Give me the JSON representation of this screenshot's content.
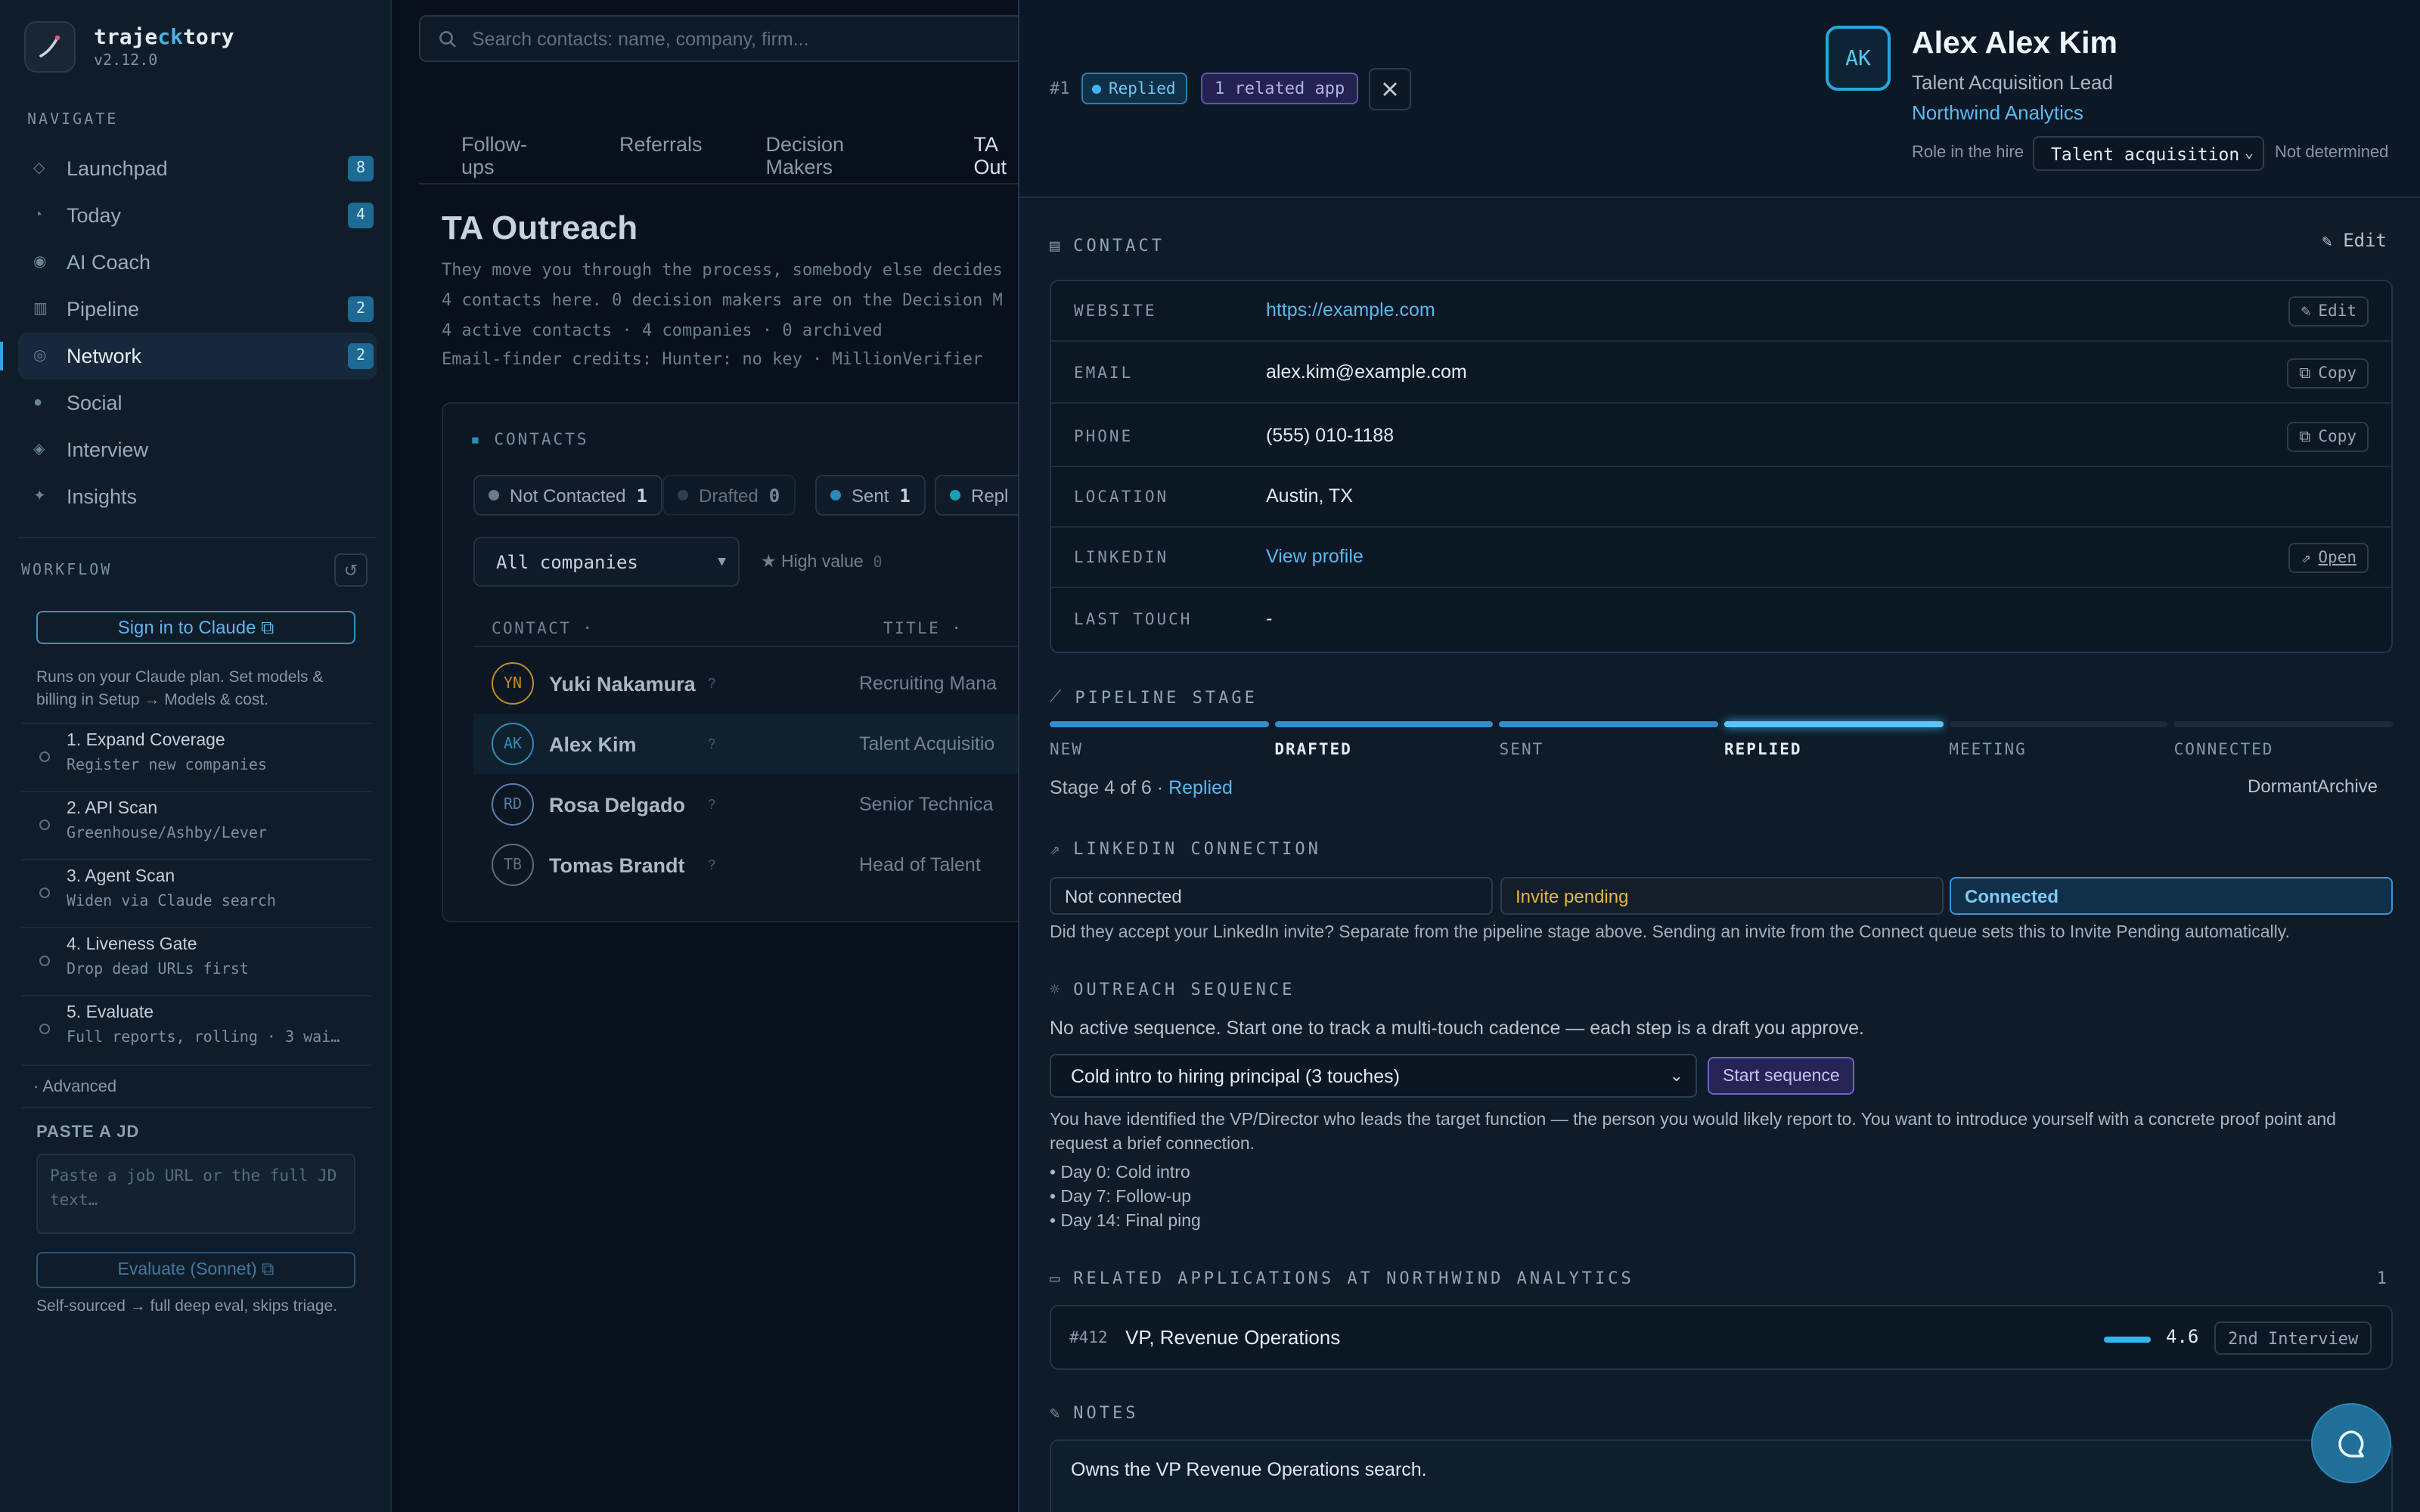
{
  "sidebar": {
    "brand": {
      "name_a": "traje",
      "name_hl": "ck",
      "name_b": "tory",
      "version": "v2.12.0"
    },
    "navigate_label": "NAVIGATE",
    "items": [
      {
        "label": "Launchpad",
        "icon": "diamond-icon",
        "glyph": "◇",
        "badge": "8"
      },
      {
        "label": "Today",
        "icon": "clock-icon",
        "glyph": "◔",
        "badge": "4"
      },
      {
        "label": "AI Coach",
        "icon": "target-icon",
        "glyph": "◉",
        "badge": ""
      },
      {
        "label": "Pipeline",
        "icon": "columns-icon",
        "glyph": "▥",
        "badge": "2"
      },
      {
        "label": "Network",
        "icon": "network-icon",
        "glyph": "◎",
        "badge": "2"
      },
      {
        "label": "Social",
        "icon": "circle-icon",
        "glyph": "●",
        "badge": ""
      },
      {
        "label": "Interview",
        "icon": "diamond-icon",
        "glyph": "◈",
        "badge": ""
      },
      {
        "label": "Insights",
        "icon": "sparkle-icon",
        "glyph": "✦",
        "badge": ""
      }
    ],
    "workflow_label": "WORKFLOW",
    "signin_label": "Sign in to Claude ⧉",
    "signin_note": "Runs on your Claude plan. Set models & billing in Setup → Models & cost.",
    "workflow": [
      {
        "title": "1. Expand Coverage",
        "sub": "Register new companies"
      },
      {
        "title": "2. API Scan",
        "sub": "Greenhouse/Ashby/Lever"
      },
      {
        "title": "3. Agent Scan",
        "sub": "Widen via Claude search"
      },
      {
        "title": "4. Liveness Gate",
        "sub": "Drop dead URLs first"
      },
      {
        "title": "5. Evaluate",
        "sub": "Full reports, rolling · 3 wai…"
      }
    ],
    "advanced_label": "Advanced",
    "paste_label": "PASTE A JD",
    "paste_placeholder": "Paste a job URL or the full JD text…",
    "evaluate_label": "Evaluate (Sonnet) ⧉",
    "evaluate_note": "Self-sourced → full deep eval, skips triage."
  },
  "main": {
    "search_placeholder": "Search contacts: name, company, firm...",
    "tabs": [
      "Follow-ups",
      "Referrals",
      "Decision Makers",
      "TA Out"
    ],
    "title": "TA Outreach",
    "desc_lines": [
      "They move you through the process, somebody else decides",
      "4 contacts here. 0 decision makers are on the Decision M",
      "4 active contacts · 4 companies · 0 archived",
      "Email-finder credits:  Hunter: no key  ·  MillionVerifier"
    ],
    "contacts_label": "CONTACTS",
    "chips": [
      {
        "label": "Not Contacted",
        "count": "1",
        "color": "#6b7b8c"
      },
      {
        "label": "Drafted",
        "count": "0",
        "color": "#4a5b6c"
      },
      {
        "label": "Sent",
        "count": "1",
        "color": "#2e86c0"
      },
      {
        "label": "Repl",
        "count": "",
        "color": "#1b9fb5"
      }
    ],
    "company_filter": "All companies",
    "high_value_label": "★ High value",
    "high_value_count": "0",
    "col_contact": "CONTACT ·",
    "col_title": "TITLE ·",
    "rows": [
      {
        "initials": "YN",
        "name": "Yuki Nakamura",
        "q": "?",
        "title": "Recruiting Mana",
        "color": "#c48a24"
      },
      {
        "initials": "AK",
        "name": "Alex Kim",
        "q": "?",
        "title": "Talent Acquisitio",
        "color": "#2b8fb8"
      },
      {
        "initials": "RD",
        "name": "Rosa Delgado",
        "q": "?",
        "title": "Senior Technica",
        "color": "#5b7fa8"
      },
      {
        "initials": "TB",
        "name": "Tomas Brandt",
        "q": "?",
        "title": "Head of Talent",
        "color": "#5d6d7e"
      }
    ]
  },
  "panel": {
    "number": "#1",
    "status_badge": "Replied",
    "related_badge": "1 related app",
    "avatar_initials": "AK",
    "name": "Alex Alex Kim",
    "title": "Talent Acquisition Lead",
    "company": "Northwind Analytics",
    "role_label": "Role in the hire",
    "role_value": "Talent acquisition",
    "role_status": "Not determined",
    "contact_header": "CONTACT",
    "edit_label": "Edit",
    "contact_rows": [
      {
        "key": "WEBSITE",
        "value": "https://example.com",
        "link": true,
        "action": "Edit",
        "action_icon": "pencil-icon",
        "glyph": "✎"
      },
      {
        "key": "EMAIL",
        "value": "alex.kim@example.com",
        "link": false,
        "action": "Copy",
        "action_icon": "copy-icon",
        "glyph": "⧉"
      },
      {
        "key": "PHONE",
        "value": "(555) 010-1188",
        "link": false,
        "action": "Copy",
        "action_icon": "copy-icon",
        "glyph": "⧉"
      },
      {
        "key": "LOCATION",
        "value": "Austin, TX",
        "link": false,
        "action": "",
        "action_icon": "",
        "glyph": ""
      },
      {
        "key": "LINKEDIN",
        "value": "View profile",
        "link": true,
        "action": "Open",
        "action_icon": "external-link-icon",
        "glyph": "⇗"
      },
      {
        "key": "LAST TOUCH",
        "value": "-",
        "link": false,
        "action": "",
        "action_icon": "",
        "glyph": ""
      }
    ],
    "pipeline_header": "PIPELINE STAGE",
    "stages": [
      "NEW",
      "DRAFTED",
      "SENT",
      "REPLIED",
      "MEETING",
      "CONNECTED"
    ],
    "stage_current": 4,
    "stage_prefix": "Stage 4 of 6 ·",
    "stage_name": "Replied",
    "dormant_label": "Dormant",
    "archive_label": "Archive",
    "linkedin_header": "LINKEDIN CONNECTION",
    "linkedin_options": [
      "Not connected",
      "Invite pending",
      "Connected"
    ],
    "linkedin_note": "Did they accept your LinkedIn invite? Separate from the pipeline stage above. Sending an invite from the Connect queue sets this to Invite Pending automatically.",
    "sequence_header": "OUTREACH SEQUENCE",
    "sequence_note": "No active sequence. Start one to track a multi-touch cadence — each step is a draft you approve.",
    "sequence_select": "Cold intro to hiring principal (3 touches)",
    "sequence_button": "Start sequence",
    "sequence_desc": "You have identified the VP/Director who leads the target function — the person you would likely report to. You want to introduce yourself with a concrete proof point and request a brief connection.",
    "sequence_steps": [
      "• Day 0: Cold intro",
      "• Day 7: Follow-up",
      "• Day 14: Final ping"
    ],
    "related_header": "RELATED APPLICATIONS AT NORTHWIND ANALYTICS",
    "related_count": "1",
    "related_app": {
      "id": "#412",
      "title": "VP, Revenue Operations",
      "score": "4.6",
      "score_fraction": 0.92,
      "status": "2nd Interview"
    },
    "notes_header": "NOTES",
    "notes_text": "Owns the VP Revenue Operations search."
  },
  "colors": {
    "accent": "#3aa0e0",
    "link": "#5ab8ef",
    "purple": "#6a66c4",
    "amber": "#e3b64a"
  }
}
